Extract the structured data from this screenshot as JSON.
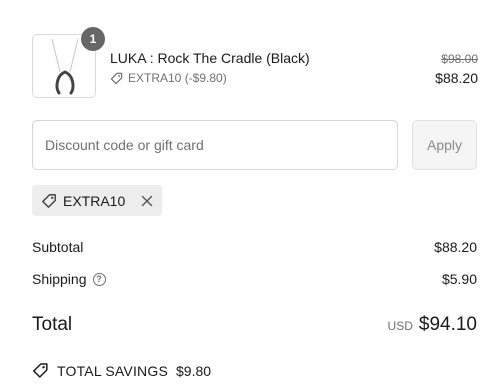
{
  "line_item": {
    "quantity": "1",
    "name": "LUKA : Rock The Cradle (Black)",
    "discount": "EXTRA10 (-$9.80)",
    "original_price": "$98.00",
    "price": "$88.20"
  },
  "discount_form": {
    "placeholder": "Discount code or gift card",
    "apply_label": "Apply"
  },
  "applied_code": {
    "code": "EXTRA10"
  },
  "summary": {
    "subtotal_label": "Subtotal",
    "subtotal_value": "$88.20",
    "shipping_label": "Shipping",
    "shipping_help": "?",
    "shipping_value": "$5.90",
    "total_label": "Total",
    "currency": "USD",
    "total_value": "$94.10"
  },
  "savings": {
    "label": "TOTAL SAVINGS",
    "value": "$9.80"
  },
  "icons": {
    "tag": "tag-icon",
    "close": "close-icon",
    "help": "question-circle-icon",
    "savings": "savings-tag-icon"
  }
}
